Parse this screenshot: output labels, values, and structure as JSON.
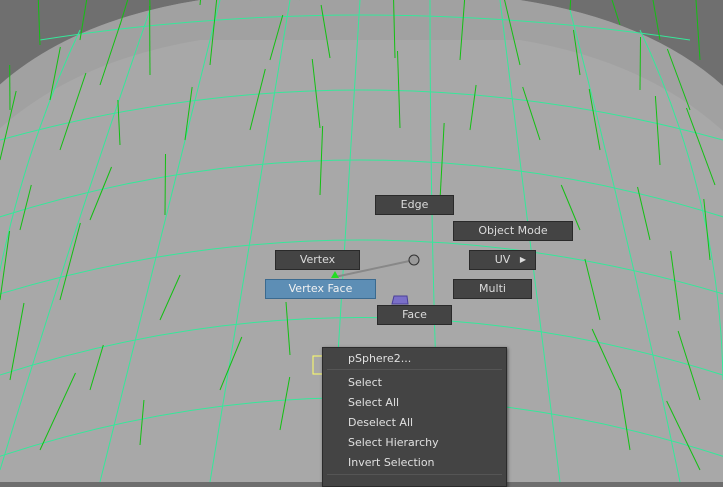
{
  "marking_menu": {
    "edge": "Edge",
    "object_mode": "Object Mode",
    "vertex": "Vertex",
    "uv": "UV",
    "vertex_face": "Vertex Face",
    "multi": "Multi",
    "face": "Face"
  },
  "context_menu": {
    "header": "pSphere2...",
    "items": [
      "Select",
      "Select All",
      "Deselect All",
      "Select Hierarchy",
      "Invert Selection"
    ]
  },
  "colors": {
    "mesh_fill": "#a8a8a8",
    "wireframe": "#35e89a",
    "normals": "#12c012",
    "background": "#6e6e6e",
    "menu_bg": "#444444",
    "highlight": "#5d8eb5"
  }
}
